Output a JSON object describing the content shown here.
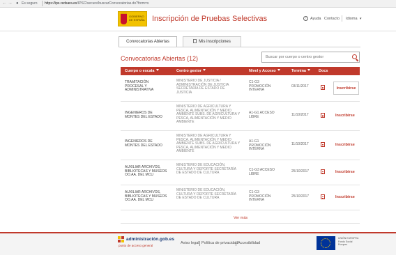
{
  "browser": {
    "secure_label": "Es seguro",
    "url_host": "https://ips.redsara.es",
    "url_path": "/IPSC/secure/buscarConvocatorias.do?form=s"
  },
  "header": {
    "logo_text": "GOBIERNO DE ESPAÑA",
    "title": "Inscripción de Pruebas Selectivas",
    "help": "Ayuda",
    "contact": "Contacto",
    "language": "Idioma"
  },
  "tabs": [
    {
      "label": "Convocatorias Abiertas"
    },
    {
      "label": "Mis inscripciones"
    }
  ],
  "section_title": "Convocatorias Abiertas (12)",
  "search": {
    "placeholder": "Buscar por cuerpo o centro gestor"
  },
  "table": {
    "headers": [
      "Cuerpo o escala",
      "Centro gestor",
      "Nivel y Acceso",
      "Termina",
      "Docs"
    ],
    "rows": [
      {
        "cuerpo": "TRAMITACIÓN PROCESAL Y ADMINISTRATIVA",
        "gestor": "MINISTERIO DE JUSTICIA / ADMINISTRACIÓN DE JUSTICIA SECRETARÍA DE ESTADO DE JUSTICIA",
        "nivel": "C1-G3 PROMOCIÓN INTERNA",
        "termina": "03/11/2017",
        "action": "Inscribirse"
      },
      {
        "cuerpo": "INGENIEROS DE MONTES DEL ESTADO",
        "gestor": "MINISTERIO DE AGRICULTURA Y PESCA, ALIMENTACIÓN Y MEDIO AMBIENTE SUBS. DE AGRICULTURA Y PESCA, ALIMENTACIÓN Y MEDIO AMBIENTE",
        "nivel": "A1-G1 ACCESO LIBRE",
        "termina": "11/10/2017",
        "action": "Inscribirse"
      },
      {
        "cuerpo": "INGENIEROS DE MONTES DEL ESTADO",
        "gestor": "MINISTERIO DE AGRICULTURA Y PESCA, ALIMENTACIÓN Y MEDIO AMBIENTE SUBS. DE AGRICULTURA Y PESCA, ALIMENTACIÓN Y MEDIO AMBIENTE",
        "nivel": "A1-G1 PROMOCIÓN INTERNA",
        "termina": "11/10/2017",
        "action": "Inscribirse"
      },
      {
        "cuerpo": "AUXILIAR ARCHIVOS, BIBLIOTECAS Y MUSEOS OO.AA. DEL MCU",
        "gestor": "MINISTERIO DE EDUCACIÓN, CULTURA Y DEPORTE SECRETARÍA DE ESTADO DE CULTURA",
        "nivel": "C1-G3 ACCESO LIBRE",
        "termina": "25/10/2017",
        "action": "Inscribirse"
      },
      {
        "cuerpo": "AUXILIAR ARCHIVOS, BIBLIOTECAS Y MUSEOS OO.AA. DEL MCU",
        "gestor": "MINISTERIO DE EDUCACIÓN, CULTURA Y DEPORTE SECRETARÍA DE ESTADO DE CULTURA",
        "nivel": "C1-G3 PROMOCIÓN INTERNA",
        "termina": "25/10/2017",
        "action": "Inscribirse"
      }
    ]
  },
  "ver_mas": "Ver más",
  "footer": {
    "brand": "administración.gob.es",
    "brand_sub": "punto de acceso general",
    "links": [
      "Aviso legal",
      "Política de privacidad",
      "Accesibilidad"
    ],
    "eu_text": "UNIÓN EUROPEA Fondo Social Europeo"
  },
  "colors": {
    "accent": "#c0392b",
    "logo_yellow": "#f2c200",
    "eu_blue": "#003399"
  },
  "icons": [
    "lock-icon",
    "help-icon",
    "search-icon",
    "document-icon",
    "tab-doc-icon"
  ]
}
